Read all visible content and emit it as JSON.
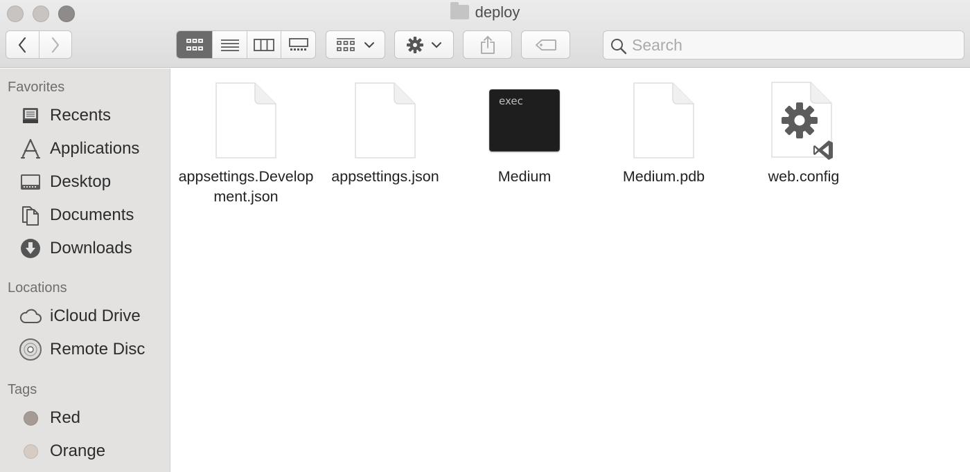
{
  "window": {
    "title": "deploy"
  },
  "toolbar": {
    "search_placeholder": "Search"
  },
  "sidebar": {
    "favorites_title": "Favorites",
    "favorites": [
      {
        "label": "Recents",
        "icon": "recents-icon"
      },
      {
        "label": "Applications",
        "icon": "applications-icon"
      },
      {
        "label": "Desktop",
        "icon": "desktop-icon"
      },
      {
        "label": "Documents",
        "icon": "documents-icon"
      },
      {
        "label": "Downloads",
        "icon": "downloads-icon"
      }
    ],
    "locations_title": "Locations",
    "locations": [
      {
        "label": "iCloud Drive",
        "icon": "cloud-icon"
      },
      {
        "label": "Remote Disc",
        "icon": "disc-icon"
      }
    ],
    "tags_title": "Tags",
    "tags": [
      {
        "label": "Red",
        "color": "#a59b94"
      },
      {
        "label": "Orange",
        "color": "#d6ccc3"
      }
    ]
  },
  "files": [
    {
      "name": "appsettings.Development.json",
      "icon": "document-icon"
    },
    {
      "name": "appsettings.json",
      "icon": "document-icon"
    },
    {
      "name": "Medium",
      "icon": "exec-icon",
      "badge": "exec"
    },
    {
      "name": "Medium.pdb",
      "icon": "document-icon"
    },
    {
      "name": "web.config",
      "icon": "config-file-icon"
    }
  ]
}
